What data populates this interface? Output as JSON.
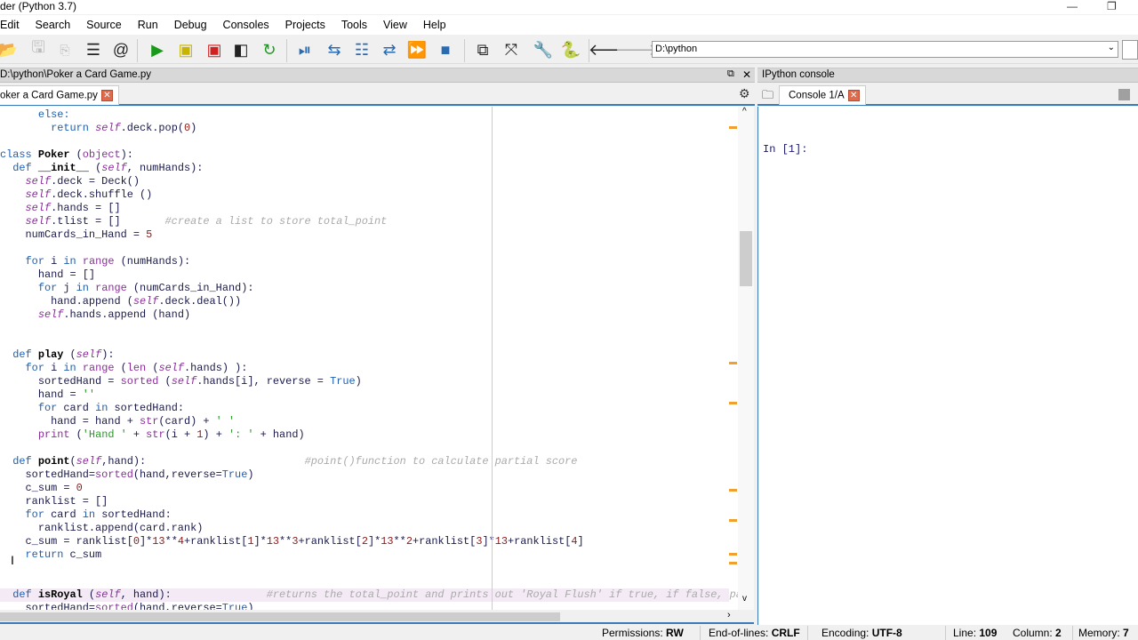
{
  "window": {
    "title": "der (Python 3.7)"
  },
  "menu": [
    "Edit",
    "Search",
    "Source",
    "Run",
    "Debug",
    "Consoles",
    "Projects",
    "Tools",
    "View",
    "Help"
  ],
  "toolbar": {
    "path": "D:\\python"
  },
  "editor": {
    "pane_title": "D:\\python\\Poker a Card Game.py",
    "tab_label": "oker a Card Game.py",
    "lines": [
      "      else:",
      "        return self.deck.pop(0)",
      "",
      "class Poker (object):",
      "  def __init__ (self, numHands):",
      "    self.deck = Deck()",
      "    self.deck.shuffle ()",
      "    self.hands = []",
      "    self.tlist = []       #create a list to store total_point",
      "    numCards_in_Hand = 5",
      "",
      "    for i in range (numHands):",
      "      hand = []",
      "      for j in range (numCards_in_Hand):",
      "        hand.append (self.deck.deal())",
      "      self.hands.append (hand)",
      "",
      "",
      "  def play (self):",
      "    for i in range (len (self.hands) ):",
      "      sortedHand = sorted (self.hands[i], reverse = True)",
      "      hand = ''",
      "      for card in sortedHand:",
      "        hand = hand + str(card) + ' '",
      "      print ('Hand ' + str(i + 1) + ': ' + hand)",
      "",
      "  def point(self,hand):                         #point()function to calculate partial score",
      "    sortedHand=sorted(hand,reverse=True)",
      "    c_sum = 0",
      "    ranklist = []",
      "    for card in sortedHand:",
      "      ranklist.append(card.rank)",
      "    c_sum = ranklist[0]*13**4+ranklist[1]*13**3+ranklist[2]*13**2+ranklist[3]*13+ranklist[4]",
      "    return c_sum",
      "",
      "",
      "  def isRoyal (self, hand):               #returns the total_point and prints out 'Royal Flush' if true, if false, pa",
      "    sortedHand=sorted(hand,reverse=True)"
    ]
  },
  "console": {
    "pane_title": "IPython console",
    "tab_label": "Console 1/A",
    "prompt": "In [1]:"
  },
  "status": {
    "permissions_label": "Permissions:",
    "permissions": "RW",
    "eol_label": "End-of-lines:",
    "eol": "CRLF",
    "encoding_label": "Encoding:",
    "encoding": "UTF-8",
    "line_label": "Line:",
    "line": "109",
    "column_label": "Column:",
    "column": "2",
    "memory_label": "Memory:",
    "memory": "7"
  }
}
